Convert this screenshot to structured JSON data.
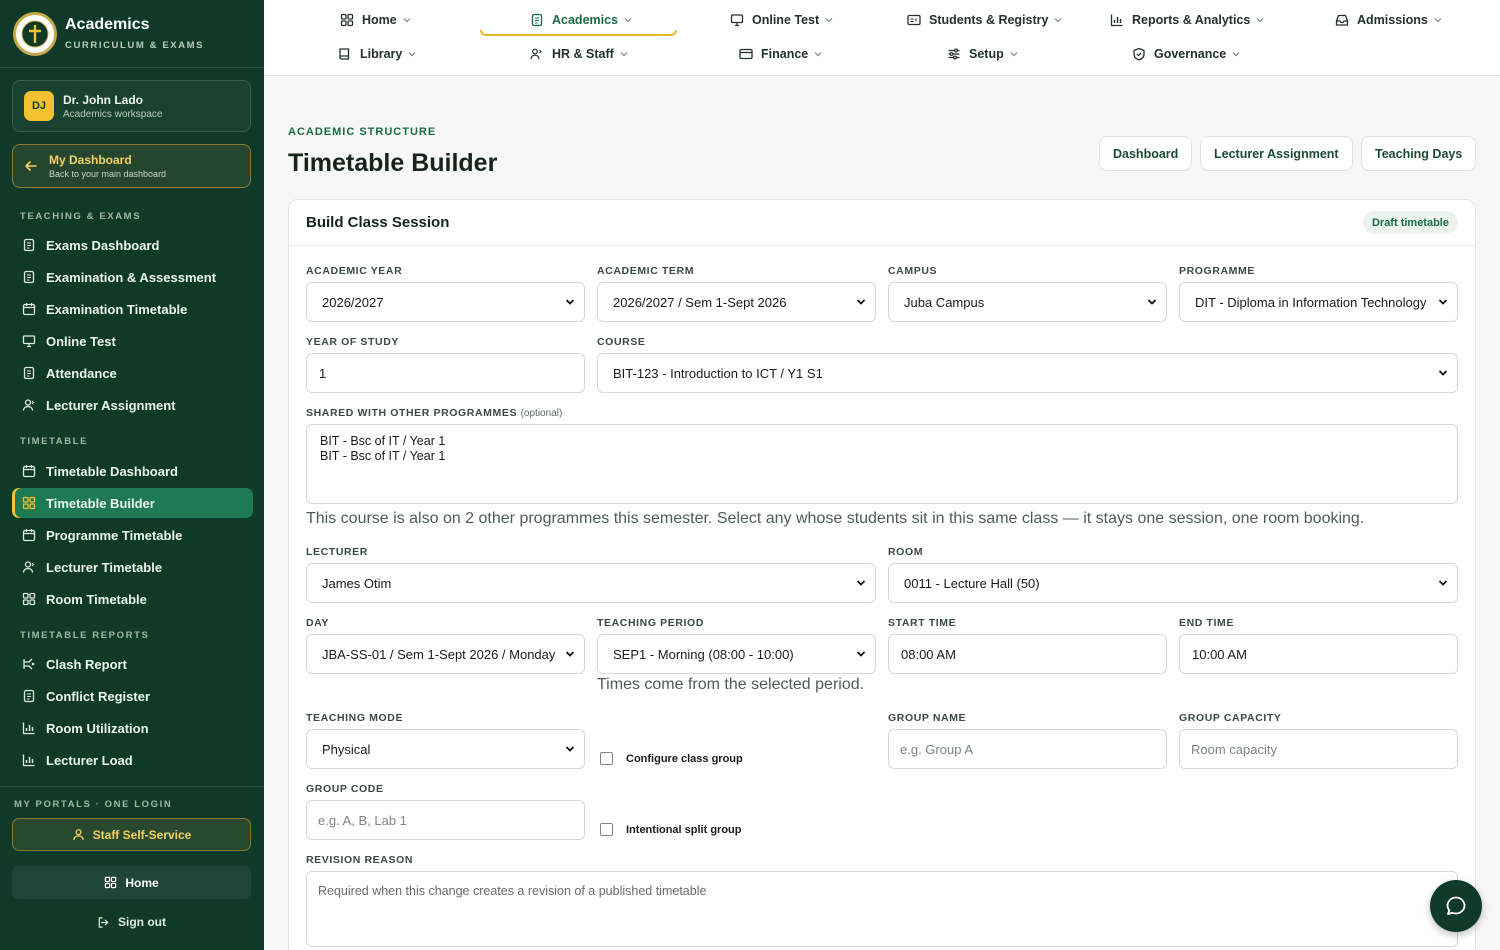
{
  "brand": {
    "name": "Academics",
    "subtitle": "CURRICULUM & EXAMS"
  },
  "user": {
    "initials": "DJ",
    "name": "Dr. John Lado",
    "role": "Academics workspace"
  },
  "my_dashboard": {
    "title": "My Dashboard",
    "subtitle": "Back to your main dashboard"
  },
  "sidebar": {
    "sections": [
      {
        "heading": "TEACHING & EXAMS",
        "items": [
          {
            "label": "Exams Dashboard",
            "icon": "document-icon"
          },
          {
            "label": "Examination & Assessment",
            "icon": "document-icon"
          },
          {
            "label": "Examination Timetable",
            "icon": "calendar-icon"
          },
          {
            "label": "Online Test",
            "icon": "monitor-icon"
          },
          {
            "label": "Attendance",
            "icon": "document-icon"
          },
          {
            "label": "Lecturer Assignment",
            "icon": "user-icon"
          }
        ]
      },
      {
        "heading": "TIMETABLE",
        "items": [
          {
            "label": "Timetable Dashboard",
            "icon": "calendar-icon"
          },
          {
            "label": "Timetable Builder",
            "icon": "grid-icon",
            "active": true
          },
          {
            "label": "Programme Timetable",
            "icon": "calendar-icon"
          },
          {
            "label": "Lecturer Timetable",
            "icon": "user-icon"
          },
          {
            "label": "Room Timetable",
            "icon": "grid-icon"
          }
        ]
      },
      {
        "heading": "TIMETABLE REPORTS",
        "items": [
          {
            "label": "Clash Report",
            "icon": "branch-icon"
          },
          {
            "label": "Conflict Register",
            "icon": "document-icon"
          },
          {
            "label": "Room Utilization",
            "icon": "bar-chart-icon"
          },
          {
            "label": "Lecturer Load",
            "icon": "bar-chart-icon"
          }
        ]
      }
    ],
    "portals_heading": "MY PORTALS · ONE LOGIN",
    "staff_self_service": "Staff Self-Service",
    "home": "Home",
    "sign_out": "Sign out"
  },
  "topnav": [
    {
      "label": "Home",
      "icon": "grid-icon"
    },
    {
      "label": "Academics",
      "icon": "document-icon",
      "active": true
    },
    {
      "label": "Online Test",
      "icon": "monitor-icon"
    },
    {
      "label": "Students & Registry",
      "icon": "id-card-icon"
    },
    {
      "label": "Reports & Analytics",
      "icon": "bar-chart-icon"
    },
    {
      "label": "Admissions",
      "icon": "inbox-icon"
    },
    {
      "label": "Library",
      "icon": "book-icon"
    },
    {
      "label": "HR & Staff",
      "icon": "users-icon"
    },
    {
      "label": "Finance",
      "icon": "card-icon"
    },
    {
      "label": "Setup",
      "icon": "sliders-icon"
    },
    {
      "label": "Governance",
      "icon": "shield-icon"
    }
  ],
  "page": {
    "eyebrow": "ACADEMIC STRUCTURE",
    "title": "Timetable Builder",
    "actions": [
      "Dashboard",
      "Lecturer Assignment",
      "Teaching Days"
    ]
  },
  "form": {
    "card_title": "Build Class Session",
    "status_badge": "Draft timetable",
    "academic_year": {
      "label": "ACADEMIC YEAR",
      "value": "2026/2027"
    },
    "academic_term": {
      "label": "ACADEMIC TERM",
      "value": "2026/2027 / Sem 1-Sept 2026"
    },
    "campus": {
      "label": "CAMPUS",
      "value": "Juba Campus"
    },
    "programme": {
      "label": "PROGRAMME",
      "value": "DIT - Diploma in Information Technology"
    },
    "year_of_study": {
      "label": "YEAR OF STUDY",
      "value": "1"
    },
    "course": {
      "label": "COURSE",
      "value": "BIT-123 - Introduction to ICT / Y1 S1"
    },
    "shared": {
      "label": "SHARED WITH OTHER PROGRAMMES",
      "optional": "(optional)",
      "options": [
        "BIT - Bsc of IT / Year 1",
        "BIT - Bsc of IT / Year 1"
      ],
      "hint": "This course is also on 2 other programmes this semester. Select any whose students sit in this same class — it stays one session, one room booking."
    },
    "lecturer": {
      "label": "LECTURER",
      "value": "James Otim"
    },
    "room": {
      "label": "ROOM",
      "value": "0011 - Lecture Hall (50)"
    },
    "day": {
      "label": "DAY",
      "value": "JBA-SS-01 / Sem 1-Sept 2026 / Monday"
    },
    "teaching_period": {
      "label": "TEACHING PERIOD",
      "value": "SEP1 - Morning (08:00 - 10:00)",
      "hint": "Times come from the selected period."
    },
    "start_time": {
      "label": "START TIME",
      "value": "08:00 AM"
    },
    "end_time": {
      "label": "END TIME",
      "value": "10:00 AM"
    },
    "teaching_mode": {
      "label": "TEACHING MODE",
      "value": "Physical"
    },
    "configure_class_group": "Configure class group",
    "intentional_split_group": "Intentional split group",
    "group_name": {
      "label": "GROUP NAME",
      "placeholder": "e.g. Group A"
    },
    "group_capacity": {
      "label": "GROUP CAPACITY",
      "placeholder": "Room capacity"
    },
    "group_code": {
      "label": "GROUP CODE",
      "placeholder": "e.g. A, B, Lab 1"
    },
    "revision_reason": {
      "label": "REVISION REASON",
      "placeholder": "Required when this change creates a revision of a published timetable"
    }
  },
  "colors": {
    "sidebar_bg": "#0f3a2a",
    "accent_green": "#1e7a52",
    "accent_gold": "#f2c230"
  }
}
